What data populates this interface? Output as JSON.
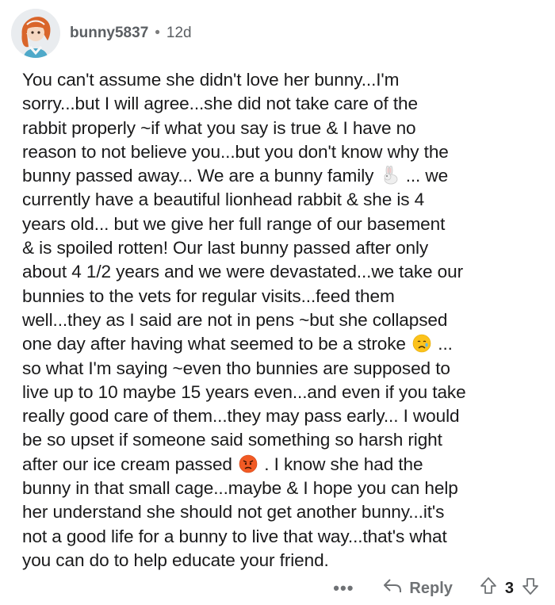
{
  "comment": {
    "username": "bunny5837",
    "separator": "•",
    "age": "12d",
    "lines": [
      "You can't assume she didn't love her bunny...I'm",
      "sorry...but I will agree...she did not take care of the",
      "rabbit properly ~if what you say is true & I have no",
      "reason to not believe you...but you don't know why the",
      "bunny passed away... We are a bunny family",
      "... we",
      "currently have a beautiful lionhead rabbit & she is 4",
      "years old... but we give her full range of our basement",
      "& is spoiled rotten! Our last bunny passed after only",
      "about 4 1/2 years and we were devastated...we take our",
      "bunnies to the vets for regular visits...feed them",
      "well...they as I said are not in pens ~but she collapsed",
      "one day after having what seemed to be a stroke",
      "...",
      "so what I'm saying ~even tho bunnies are supposed to",
      "live up to 10 maybe 15 years even...and even if you take",
      "really good care of them...they may pass early... I would",
      "be so upset if someone said something so harsh right",
      "after our ice cream passed",
      ". I know she had the",
      "bunny in that small cage...maybe & I hope you can help",
      "her understand she should not get another bunny...it's",
      "not a good life for a bunny to live that way...that's what",
      "you can do to help educate your friend."
    ],
    "emojis": {
      "rabbit": "rabbit-emoji-icon",
      "sad": "sad-face-emoji-icon",
      "angry": "angry-face-emoji-icon"
    }
  },
  "footer": {
    "more": "•••",
    "reply_label": "Reply",
    "score": "3"
  },
  "colors": {
    "text": "#1a1a1b",
    "meta": "#5b5f63",
    "icon": "#6f7275"
  }
}
